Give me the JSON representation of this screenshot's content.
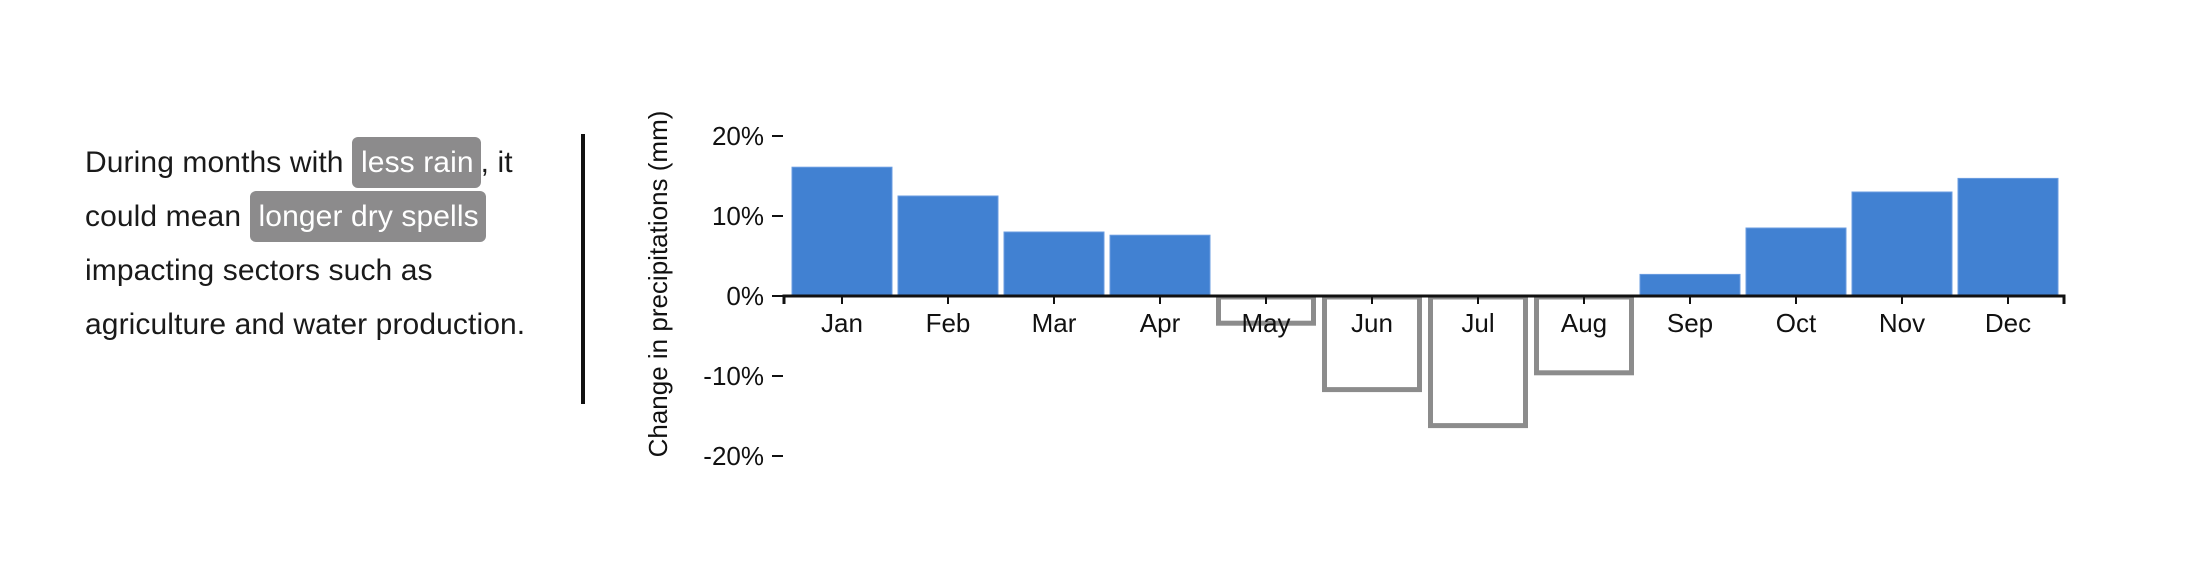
{
  "narrative": {
    "before_1": "During months with ",
    "highlight_1": "less rain",
    "after_1": ", it could mean ",
    "highlight_2": "longer dry spells",
    "after_2": " impacting sectors such as agriculture and water production."
  },
  "colors": {
    "positive_bar": "#4181d2",
    "negative_bar_stroke": "#8c8c8c",
    "highlight_bg": "#8c8b8c",
    "axis": "#111111"
  },
  "chart_data": {
    "type": "bar",
    "title": "",
    "xlabel": "",
    "ylabel": "Change in precipitations (mm)",
    "categories": [
      "Jan",
      "Feb",
      "Mar",
      "Apr",
      "May",
      "Jun",
      "Jul",
      "Aug",
      "Sep",
      "Oct",
      "Nov",
      "Dec"
    ],
    "values": [
      16.1,
      12.5,
      8.0,
      7.6,
      -3.4,
      -11.7,
      -16.2,
      -9.6,
      2.7,
      8.5,
      13.0,
      14.7
    ],
    "unit": "%",
    "ylim": [
      -20,
      20
    ],
    "yticks": [
      20,
      10,
      0,
      -10,
      -20
    ],
    "ytick_labels": [
      "20%",
      "10%",
      "0%",
      "-10%",
      "-20%"
    ],
    "grid": false,
    "legend": "none",
    "style_note": "positive values filled blue, negative values drawn as gray outline"
  }
}
